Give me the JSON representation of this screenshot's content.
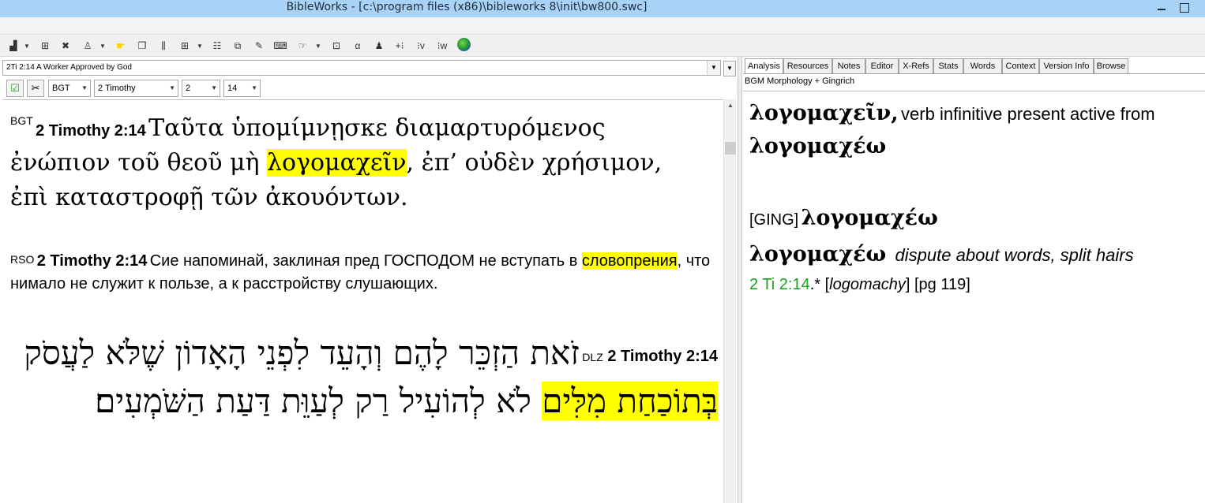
{
  "window": {
    "title": "BibleWorks - [c:\\program files (x86)\\bibleworks 8\\init\\bw800.swc]"
  },
  "toolbar": {
    "icons": [
      "chart-icon",
      "binoculars-icon",
      "tools-icon",
      "search-person-icon",
      "cursor-icon",
      "windows-icon",
      "columns-icon",
      "grid-icon",
      "list-icon",
      "copy-icon",
      "notes-icon",
      "keyboard-icon",
      "cursor-hand-icon",
      "diagram-icon",
      "text-icon",
      "tree-icon",
      "plus-icon",
      "parse-icon",
      "w-icon",
      "globe-icon"
    ]
  },
  "left": {
    "verse_selector": "2Ti 2:14 A Worker Approved by God",
    "version_select": "BGT",
    "book_select": "2 Timothy",
    "chapter_select": "2",
    "verse_select": "14",
    "bgt": {
      "code": "BGT",
      "ref": "2 Timothy 2:14",
      "text_before": "Ταῦτα ὑπομίμνῃσκε διαμαρτυρόμενος ἐνώπιον τοῦ θεοῦ μὴ ",
      "highlight": "λογομαχεῖν",
      "text_after": ", ἐπ’ οὐδὲν χρήσιμον, ἐπὶ καταστροφῇ τῶν ἀκουόντων."
    },
    "rso": {
      "code": "RSO",
      "ref": "2 Timothy 2:14",
      "text_before": "Сие напоминай, заклиная пред ГОСПОДОМ не вступать в ",
      "highlight": "словопрения",
      "text_after": ", что нимало не служит к пользе, а к расстройству слушающих."
    },
    "dlz": {
      "code": "DLZ",
      "ref": "2 Timothy 2:14",
      "text_before": "זֹאת הַזְכֵּר לָהֶם וְהָעֵד לִפְנֵי הָאָדוֹן שֶׁלֹּא לַעֲסֹק ",
      "highlight": "בְּתוֹכַחַת מִלִּים",
      "text_after": " לֹא לְהוֹעִיל רַק לְעַוֵּת דַּעַת הַשֹּׁמְעִים׃"
    }
  },
  "right": {
    "tabs": [
      "Analysis",
      "Resources",
      "Notes",
      "Editor",
      "X-Refs",
      "Stats",
      "Words",
      "Context",
      "Version Info",
      "Browse"
    ],
    "active_tab": "Analysis",
    "resource_label": "BGM Morphology + Gingrich",
    "analysis": {
      "word": "λογομαχεῖν,",
      "parse": "verb infinitive present active from",
      "lemma": "λογομαχέω",
      "ging_tag": "[GING]",
      "ging_lemma": "λογομαχέω",
      "entry_lemma": "λογομαχέω",
      "definition": "dispute about words, split hairs",
      "ref_link": "2 Ti 2:14",
      "ref_suffix": ".* [",
      "etym": "logomachy",
      "page": "] [pg 119]"
    }
  }
}
